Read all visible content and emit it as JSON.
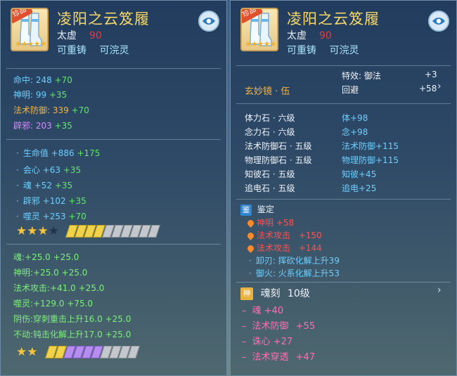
{
  "item": {
    "name": "凌阳之云笈履",
    "tag": "珍品",
    "grade": "太虚",
    "level": "90",
    "traits": [
      "可重铸",
      "可浣灵"
    ],
    "stars_icon": "★★★★★"
  },
  "left": {
    "base_stats": [
      {
        "label": "命中:",
        "value": "248",
        "bonus": "+70"
      },
      {
        "label": "神明:",
        "value": "99",
        "bonus": "+35"
      },
      {
        "label": "法术防御:",
        "value": "339",
        "bonus": "+70"
      },
      {
        "label": "辟邪:",
        "value": "203",
        "bonus": "+35"
      }
    ],
    "extra_stats": [
      {
        "label": "生命值",
        "value": "+886",
        "bonus": "+175"
      },
      {
        "label": "会心",
        "value": "+63",
        "bonus": "+35"
      },
      {
        "label": "魂",
        "value": "+52",
        "bonus": "+35"
      },
      {
        "label": "辟邪",
        "value": "+102",
        "bonus": "+35"
      },
      {
        "label": "噬灵",
        "value": "+253",
        "bonus": "+70"
      }
    ],
    "star_row_1": {
      "stars": "★★★",
      "empty_star": "★",
      "gems_yellow": 4,
      "gems_gray": 6
    },
    "refine_stats": [
      {
        "label": "魂:",
        "value": "+25.0",
        "bonus": "+25.0"
      },
      {
        "label": "神明:",
        "value": "+25.0",
        "bonus": "+25.0"
      },
      {
        "label": "法术攻击:",
        "value": "+41.0",
        "bonus": "+25.0"
      },
      {
        "label": "噬灵:",
        "value": "+129.0",
        "bonus": "+75.0"
      },
      {
        "label": "阴伤:",
        "value": "穿刺重击上升16.0",
        "bonus": "+25.0"
      },
      {
        "label": "不动:",
        "value": "钝击化解上升17.0",
        "bonus": "+25.0"
      }
    ],
    "star_row_2": {
      "stars": "★★",
      "gems_yellow": 2,
      "gems_purple": 4,
      "gems_gray": 4
    }
  },
  "right": {
    "special": {
      "label": "特效:",
      "value": "御法",
      "amount": "+3"
    },
    "dodge": {
      "label": "回避",
      "amount": "+58"
    },
    "mirror": "玄妙镜 · 伍",
    "stones": [
      {
        "name": "体力石 · 六级",
        "effect": "体+98"
      },
      {
        "name": "念力石 · 六级",
        "effect": "念+98"
      },
      {
        "name": "法术防御石 · 五级",
        "effect": "法术防御+115"
      },
      {
        "name": "物理防御石 · 五级",
        "effect": "物理防御+115"
      },
      {
        "name": "知彼石 · 五级",
        "effect": "知彼+45"
      },
      {
        "name": "追电石 · 五级",
        "effect": "追电+25"
      }
    ],
    "appraise": {
      "badge": "鉴",
      "title": "鉴定",
      "lines": [
        {
          "label": "神明",
          "value": "+58"
        },
        {
          "label": "法术攻击",
          "value": "+150"
        },
        {
          "label": "法术攻击",
          "value": "+144"
        }
      ],
      "sub_lines": [
        "卸刃: 挥砍化解上升39",
        "御火: 火系化解上升53"
      ]
    },
    "soul": {
      "badge": "神",
      "title": "魂刻",
      "level": "10级",
      "lines": [
        {
          "label": "魂",
          "value": "+40"
        },
        {
          "label": "法术防御",
          "value": "+55"
        },
        {
          "label": "诛心",
          "value": "+27"
        },
        {
          "label": "法术穿透",
          "value": "+47"
        }
      ]
    }
  },
  "icons": {
    "eye": "eye-icon",
    "chevron": "chevron-right-icon",
    "flame": "flame-icon"
  }
}
